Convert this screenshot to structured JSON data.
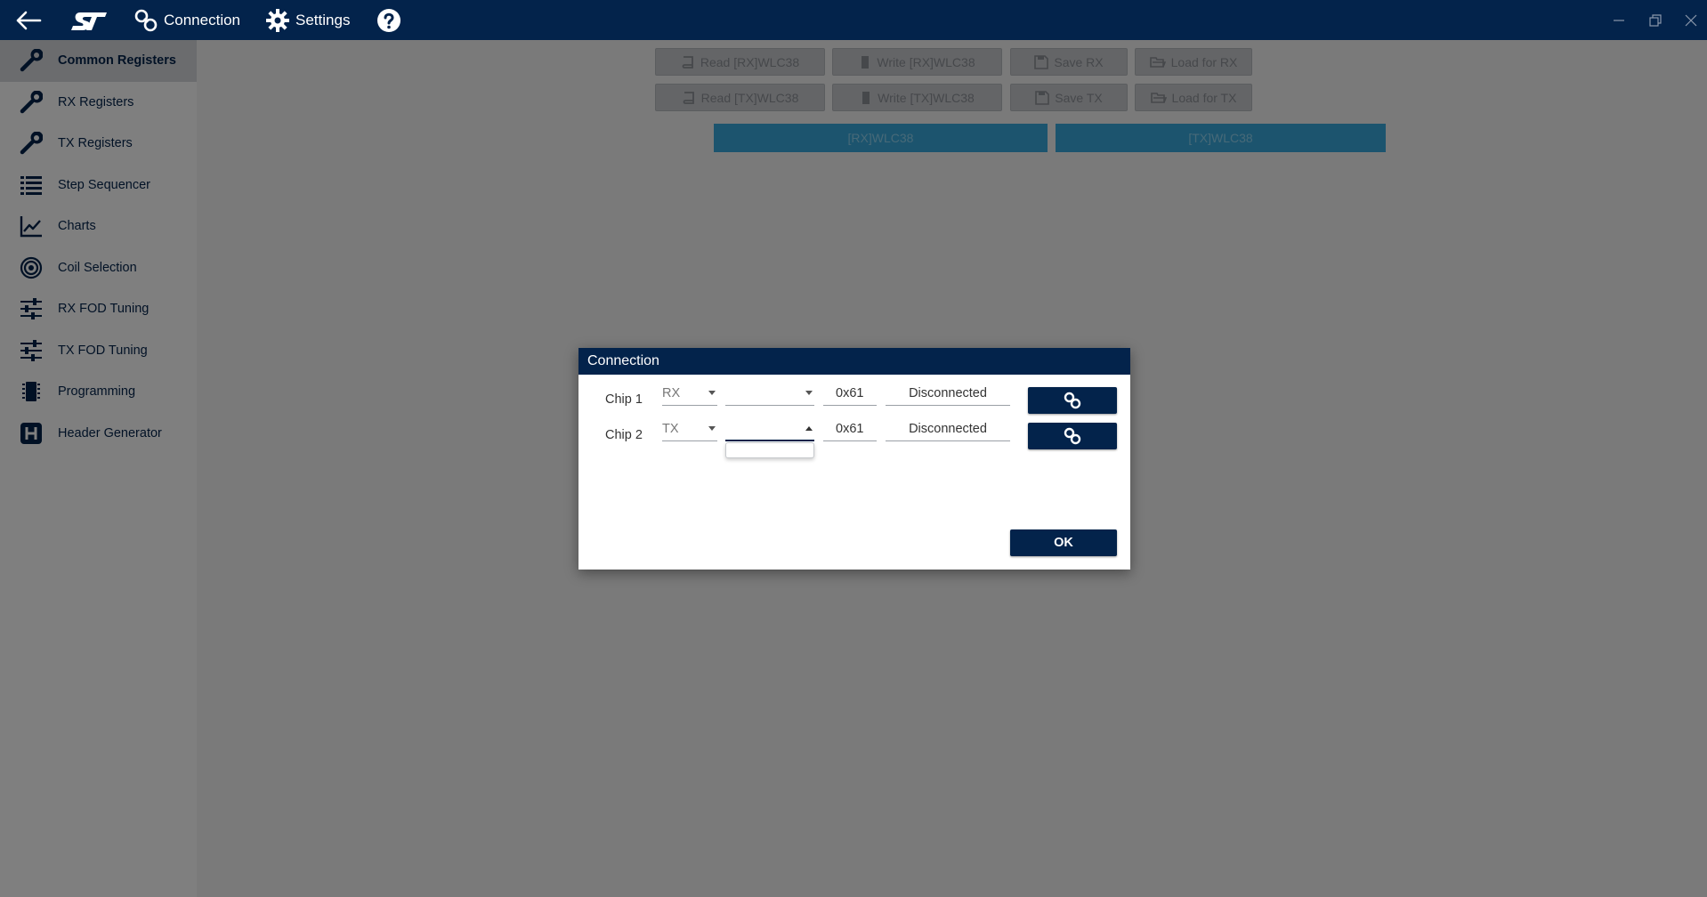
{
  "titlebar": {
    "back_icon": "arrow-left-icon",
    "logo_icon": "st-logo-icon",
    "connection_label": "Connection",
    "settings_label": "Settings",
    "help_icon": "question-circle-icon"
  },
  "sidebar": {
    "items": [
      {
        "label": "Common Registers",
        "icon": "wrench-icon",
        "active": true
      },
      {
        "label": "RX Registers",
        "icon": "wrench-icon"
      },
      {
        "label": "TX Registers",
        "icon": "wrench-icon"
      },
      {
        "label": "Step Sequencer",
        "icon": "list-icon"
      },
      {
        "label": "Charts",
        "icon": "line-chart-icon"
      },
      {
        "label": "Coil Selection",
        "icon": "coil-icon"
      },
      {
        "label": "RX FOD Tuning",
        "icon": "sliders-icon"
      },
      {
        "label": "TX FOD Tuning",
        "icon": "sliders-icon"
      },
      {
        "label": "Programming",
        "icon": "chip-icon"
      },
      {
        "label": "Header Generator",
        "icon": "h-box-icon"
      }
    ]
  },
  "toolbar": {
    "read_rx": "Read [RX]WLC38",
    "write_rx": "Write [RX]WLC38",
    "save_rx": "Save RX",
    "load_rx": "Load for RX",
    "read_tx": "Read [TX]WLC38",
    "write_tx": "Write [TX]WLC38",
    "save_tx": "Save TX",
    "load_tx": "Load for TX"
  },
  "chip_tabs": [
    "[RX]WLC38",
    "[TX]WLC38"
  ],
  "dialog": {
    "title": "Connection",
    "rows": [
      {
        "label": "Chip 1",
        "role": "RX",
        "port": "",
        "address": "0x61",
        "status": "Disconnected"
      },
      {
        "label": "Chip 2",
        "role": "TX",
        "port": "",
        "address": "0x61",
        "status": "Disconnected"
      }
    ],
    "ok_label": "OK"
  },
  "colors": {
    "brand_navy": "#03234b",
    "tab_blue": "#39a9dc",
    "sidebar_active": "#d6d8dc"
  }
}
